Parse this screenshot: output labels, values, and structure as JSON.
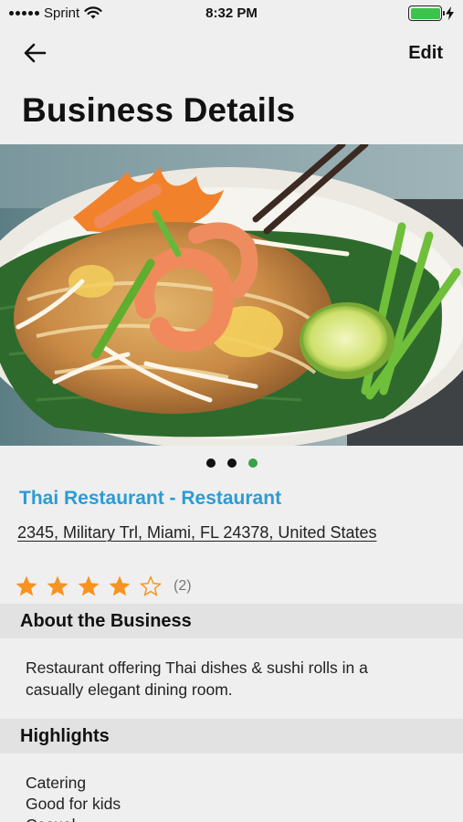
{
  "status_bar": {
    "carrier": "Sprint",
    "time": "8:32 PM",
    "battery_color": "#3cc44a"
  },
  "nav": {
    "back_icon": "arrow-left-icon",
    "edit_label": "Edit"
  },
  "page_title": "Business Details",
  "gallery": {
    "image_count": 3,
    "active_index": 2,
    "active_dot_color": "#3aa147"
  },
  "business": {
    "name": "Thai Restaurant - Restaurant",
    "name_color": "#2a9cd6",
    "address": "2345, Military Trl, Miami, FL  24378, United States",
    "rating": {
      "value": 4,
      "max": 5,
      "count_label": "(2)",
      "star_color": "#f7931e"
    }
  },
  "sections": {
    "about": {
      "title": "About the Business",
      "text": "Restaurant offering Thai dishes & sushi rolls in a casually elegant dining room."
    },
    "highlights": {
      "title": "Highlights",
      "items": [
        "Catering",
        "Good for kids",
        "Casual"
      ]
    }
  }
}
